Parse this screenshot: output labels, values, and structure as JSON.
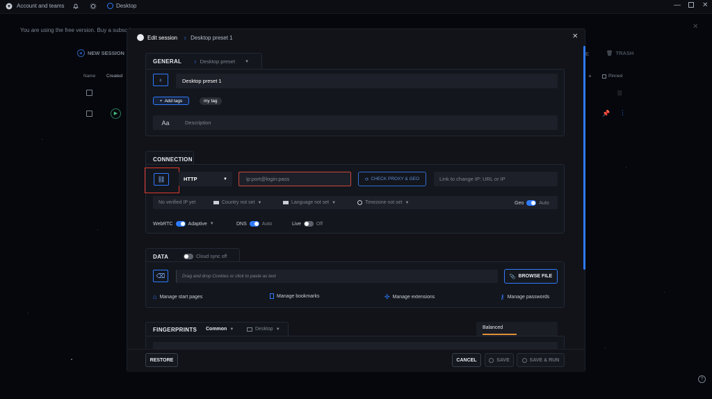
{
  "titlebar": {
    "account": "Account and teams",
    "tab": "Desktop"
  },
  "background": {
    "free_notice": "You are using the free version. Buy a subscrip",
    "new_session": "NEW SESSION",
    "trash": "TRASH",
    "col_name": "Name",
    "col_created": "Created",
    "col_pinned": "Pinned"
  },
  "modal": {
    "title": "Edit session",
    "preset_name": "Desktop preset 1"
  },
  "general": {
    "label": "GENERAL",
    "preset_select": "Desktop preset",
    "name_value": "Desktop preset 1",
    "add_tags": "Add tags",
    "tag": "my tag",
    "description_placeholder": "Description"
  },
  "connection": {
    "label": "CONNECTION",
    "proxy_type": "HTTP",
    "proxy_placeholder": "ip:port@login:pass",
    "check_proxy": "CHECK PROXY & GEO",
    "change_ip_placeholder": "Link to change IP: URL or IP",
    "no_ip": "No verified IP yet",
    "country": "Country not set",
    "language": "Language not set",
    "timezone": "Timezone not set",
    "geo_label": "Geo",
    "geo_value": "Auto",
    "webrtc_label": "WebRTC",
    "webrtc_value": "Adaptive",
    "dns_label": "DNS",
    "dns_value": "Auto",
    "live_label": "Live",
    "live_value": "Off"
  },
  "data": {
    "label": "DATA",
    "cloud_sync": "Cloud sync off",
    "drop_placeholder": "Drag and drop Cookies or click to paste as text",
    "browse_file": "BROWSE FILE",
    "start_pages": "Manage start pages",
    "bookmarks": "Manage bookmarks",
    "extensions": "Manage extensions",
    "passwords": "Manage passwords"
  },
  "fingerprints": {
    "label": "FINGERPRINTS",
    "common": "Common",
    "platform": "Desktop",
    "mode": "Balanced"
  },
  "footer": {
    "restore": "RESTORE",
    "cancel": "CANCEL",
    "save": "SAVE",
    "save_run": "SAVE & RUN"
  },
  "colors": {
    "accent": "#2f7bff",
    "highlight_red": "#e03a2e",
    "balanced_orange": "#e0903a"
  }
}
